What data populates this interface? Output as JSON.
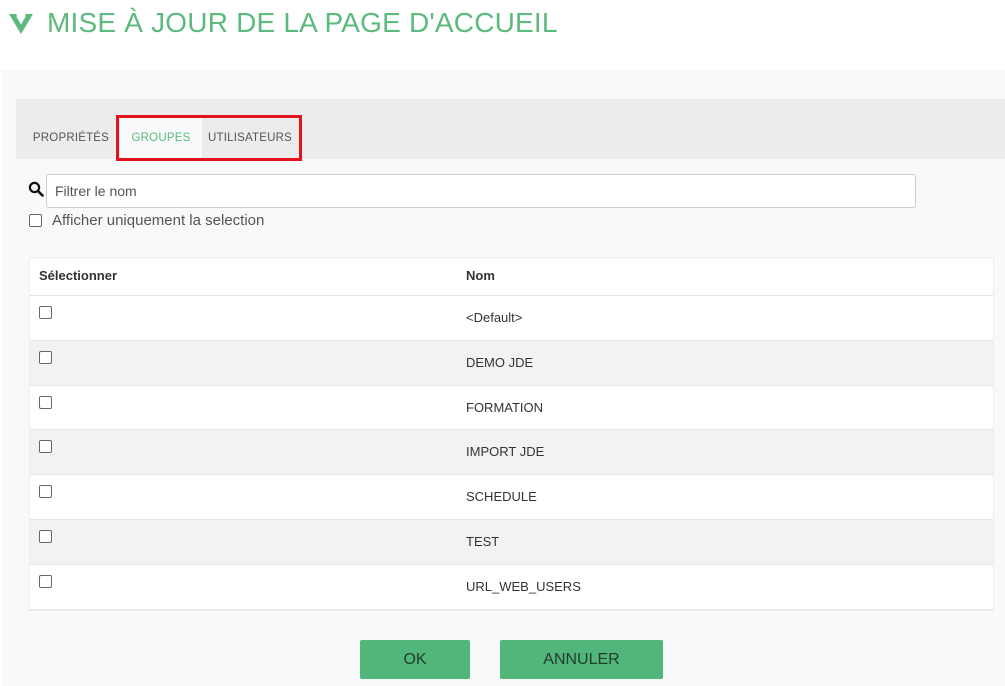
{
  "header": {
    "title": "MISE À JOUR DE LA PAGE D'ACCUEIL",
    "logo_icon": "v-logo-icon"
  },
  "colors": {
    "accent": "#5cba7d",
    "button_bg": "#52b57a",
    "highlight_border": "#e3121b"
  },
  "tabs": [
    {
      "label": "PROPRIÉTÉS",
      "active": false
    },
    {
      "label": "GROUPES",
      "active": true
    },
    {
      "label": "UTILISATEURS",
      "active": false
    }
  ],
  "filter": {
    "placeholder": "Filtrer le nom",
    "value": "",
    "search_icon": "search-icon",
    "only_selection_label": "Afficher uniquement la selection",
    "only_selection_checked": false
  },
  "table": {
    "columns": [
      "Sélectionner",
      "Nom"
    ],
    "rows": [
      {
        "selected": false,
        "name": "<Default>"
      },
      {
        "selected": false,
        "name": "DEMO JDE"
      },
      {
        "selected": false,
        "name": "FORMATION"
      },
      {
        "selected": false,
        "name": "IMPORT JDE"
      },
      {
        "selected": false,
        "name": "SCHEDULE"
      },
      {
        "selected": false,
        "name": "TEST"
      },
      {
        "selected": false,
        "name": "URL_WEB_USERS"
      }
    ]
  },
  "buttons": {
    "ok": "OK",
    "cancel": "ANNULER"
  }
}
